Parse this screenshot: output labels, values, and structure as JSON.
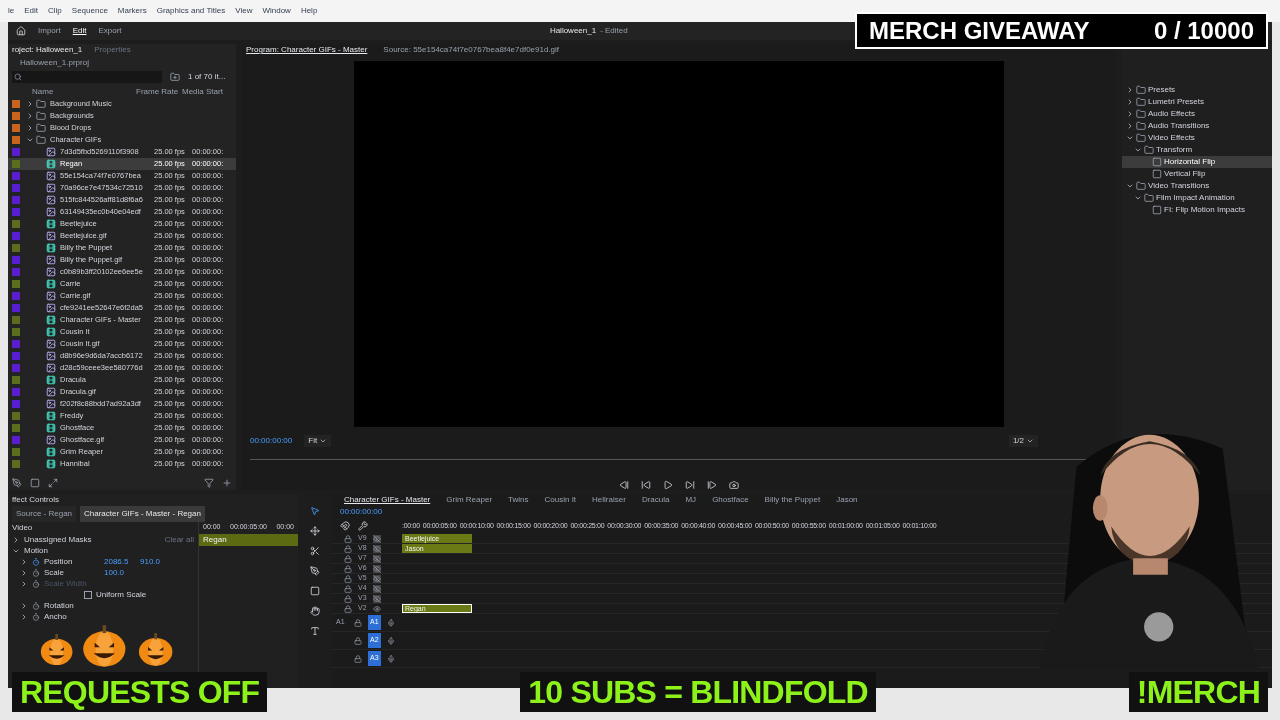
{
  "menu_bar": [
    "le",
    "Edit",
    "Clip",
    "Sequence",
    "Markers",
    "Graphics and Titles",
    "View",
    "Window",
    "Help"
  ],
  "header": {
    "workspaces": [
      {
        "label": "Import",
        "selected": false
      },
      {
        "label": "Edit",
        "selected": true
      },
      {
        "label": "Export",
        "selected": false
      }
    ],
    "title": "Halloween_1",
    "status": "- Edited"
  },
  "project": {
    "tabs": [
      {
        "label": "roject: Halloween_1",
        "selected": true
      },
      {
        "label": "Properties",
        "selected": false
      }
    ],
    "bin": "Halloween_1.prproj",
    "count": "1 of 70 it...",
    "columns": [
      "Name",
      "Frame Rate",
      "Media Start"
    ],
    "items": [
      {
        "kind": "folder",
        "name": "Background Music",
        "color": "#c8641e",
        "expanded": false,
        "selected": false
      },
      {
        "kind": "folder",
        "name": "Backgrounds",
        "color": "#c8641e",
        "expanded": false,
        "selected": false
      },
      {
        "kind": "folder",
        "name": "Blood Drops",
        "color": "#c8641e",
        "expanded": false,
        "selected": false
      },
      {
        "kind": "folder",
        "name": "Character GIFs",
        "color": "#c8641e",
        "expanded": true,
        "selected": false,
        "children": [
          {
            "kind": "gif",
            "name": "7d3d5fbd5269110f3908",
            "fps": "25.00 fps",
            "start": "00:00:00:",
            "color": "#5a1ed2",
            "selected": false
          },
          {
            "kind": "sequence",
            "name": "Regan",
            "fps": "25.00 fps",
            "start": "00:00:00:",
            "color": "#5a6e1e",
            "selected": true
          },
          {
            "kind": "gif",
            "name": "55e154ca74f7e0767bea",
            "fps": "25.00 fps",
            "start": "00:00:00:",
            "color": "#5a1ed2",
            "selected": false
          },
          {
            "kind": "gif",
            "name": "70a96ce7e47534c72510",
            "fps": "25.00 fps",
            "start": "00:00:00:",
            "color": "#5a1ed2",
            "selected": false
          },
          {
            "kind": "gif",
            "name": "515fc844526aff81d8f6a6",
            "fps": "25.00 fps",
            "start": "00:00:00:",
            "color": "#5a1ed2",
            "selected": false
          },
          {
            "kind": "gif",
            "name": "63149435ec0b40e04edf",
            "fps": "25.00 fps",
            "start": "00:00:00:",
            "color": "#5a1ed2",
            "selected": false
          },
          {
            "kind": "sequence",
            "name": "Beetlejuice",
            "fps": "25.00 fps",
            "start": "00:00:00:",
            "color": "#5a6e1e",
            "selected": false
          },
          {
            "kind": "gif",
            "name": "Beetlejuice.gif",
            "fps": "25.00 fps",
            "start": "00:00:00:",
            "color": "#5a1ed2",
            "selected": false
          },
          {
            "kind": "sequence",
            "name": "Billy the Puppet",
            "fps": "25.00 fps",
            "start": "00:00:00:",
            "color": "#5a6e1e",
            "selected": false
          },
          {
            "kind": "gif",
            "name": "Billy the Puppet.gif",
            "fps": "25.00 fps",
            "start": "00:00:00:",
            "color": "#5a1ed2",
            "selected": false
          },
          {
            "kind": "gif",
            "name": "c0b89b3ff20102ee6ee5e",
            "fps": "25.00 fps",
            "start": "00:00:00:",
            "color": "#5a1ed2",
            "selected": false
          },
          {
            "kind": "sequence",
            "name": "Carrie",
            "fps": "25.00 fps",
            "start": "00:00:00:",
            "color": "#5a6e1e",
            "selected": false
          },
          {
            "kind": "gif",
            "name": "Carrie.gif",
            "fps": "25.00 fps",
            "start": "00:00:00:",
            "color": "#5a1ed2",
            "selected": false
          },
          {
            "kind": "gif",
            "name": "cfe9241ee52647e6f2da5",
            "fps": "25.00 fps",
            "start": "00:00:00:",
            "color": "#5a1ed2",
            "selected": false
          },
          {
            "kind": "sequence",
            "name": "Character GIFs - Master",
            "fps": "25.00 fps",
            "start": "00:00:00:",
            "color": "#5a6e1e",
            "selected": false
          },
          {
            "kind": "sequence",
            "name": "Cousin It",
            "fps": "25.00 fps",
            "start": "00:00:00:",
            "color": "#5a6e1e",
            "selected": false
          },
          {
            "kind": "gif",
            "name": "Cousin It.gif",
            "fps": "25.00 fps",
            "start": "00:00:00:",
            "color": "#5a1ed2",
            "selected": false
          },
          {
            "kind": "gif",
            "name": "d8b96e9d6da7accb6172",
            "fps": "25.00 fps",
            "start": "00:00:00:",
            "color": "#5a1ed2",
            "selected": false
          },
          {
            "kind": "gif",
            "name": "d28c59ceee3ee580776d",
            "fps": "25.00 fps",
            "start": "00:00:00:",
            "color": "#5a1ed2",
            "selected": false
          },
          {
            "kind": "sequence",
            "name": "Dracula",
            "fps": "25.00 fps",
            "start": "00:00:00:",
            "color": "#5a6e1e",
            "selected": false
          },
          {
            "kind": "gif",
            "name": "Dracula.gif",
            "fps": "25.00 fps",
            "start": "00:00:00:",
            "color": "#5a1ed2",
            "selected": false
          },
          {
            "kind": "gif",
            "name": "f202f8c88bdd7ad92a3df",
            "fps": "25.00 fps",
            "start": "00:00:00:",
            "color": "#5a1ed2",
            "selected": false
          },
          {
            "kind": "sequence",
            "name": "Freddy",
            "fps": "25.00 fps",
            "start": "00:00:00:",
            "color": "#5a6e1e",
            "selected": false
          },
          {
            "kind": "sequence",
            "name": "Ghostface",
            "fps": "25.00 fps",
            "start": "00:00:00:",
            "color": "#5a6e1e",
            "selected": false
          },
          {
            "kind": "gif",
            "name": "Ghostface.gif",
            "fps": "25.00 fps",
            "start": "00:00:00:",
            "color": "#5a1ed2",
            "selected": false
          },
          {
            "kind": "sequence",
            "name": "Grim Reaper",
            "fps": "25.00 fps",
            "start": "00:00:00:",
            "color": "#5a6e1e",
            "selected": false
          },
          {
            "kind": "sequence",
            "name": "Hannibal",
            "fps": "25.00 fps",
            "start": "00:00:00:",
            "color": "#5a6e1e",
            "selected": false
          }
        ]
      }
    ]
  },
  "monitor": {
    "tabs": [
      {
        "label": "Program: Character GIFs - Master",
        "selected": true
      },
      {
        "label": "Source: 55e154ca74f7e0767bea8f4e7df0e91d.gif",
        "selected": false
      }
    ],
    "timecode": "00:00:00:00",
    "zoom": "Fit",
    "resolution": "1/2"
  },
  "effects": {
    "tree": [
      {
        "name": "Presets",
        "expanded": false,
        "selected": false
      },
      {
        "name": "Lumetri Presets",
        "expanded": false,
        "selected": false
      },
      {
        "name": "Audio Effects",
        "expanded": false,
        "selected": false
      },
      {
        "name": "Audio Transitions",
        "expanded": false,
        "selected": false
      },
      {
        "name": "Video Effects",
        "expanded": true,
        "selected": false,
        "children": [
          {
            "name": "Transform",
            "expanded": true,
            "selected": false,
            "children": [
              {
                "name": "Horizontal Flip",
                "selected": true
              },
              {
                "name": "Vertical Flip",
                "selected": false
              }
            ]
          }
        ]
      },
      {
        "name": "Video Transitions",
        "expanded": true,
        "selected": false,
        "children": [
          {
            "name": "Film Impact Animation",
            "expanded": true,
            "selected": false,
            "children": [
              {
                "name": "FI: Flip Motion Impacts",
                "selected": false
              }
            ]
          }
        ]
      }
    ]
  },
  "effect_controls": {
    "title": "ffect Controls",
    "tabs": [
      {
        "label": "Source - Regan",
        "selected": false
      },
      {
        "label": "Character GIFs - Master - Regan",
        "selected": true
      }
    ],
    "section": "Video",
    "rows": [
      {
        "kind": "group",
        "label": "Unassigned Masks",
        "action": "Clear all"
      },
      {
        "kind": "fx",
        "label": "Motion"
      },
      {
        "kind": "param",
        "label": "Position",
        "values": [
          "2086.5",
          "910.0"
        ],
        "animated": true,
        "disabled": false
      },
      {
        "kind": "param",
        "label": "Scale",
        "values": [
          "100.0"
        ],
        "animated": false,
        "disabled": false
      },
      {
        "kind": "param",
        "label": "Scale Width",
        "values": [],
        "animated": false,
        "disabled": true
      },
      {
        "kind": "checkbox",
        "label": "Uniform Scale",
        "checked": false
      },
      {
        "kind": "param",
        "label": "Rotation",
        "values": [],
        "animated": false,
        "disabled": false
      },
      {
        "kind": "param",
        "label": "Ancho",
        "values": [],
        "animated": false,
        "disabled": false
      }
    ],
    "ruler": [
      "00:00",
      "00:00:05:00",
      "00:00"
    ],
    "clip": "Regan"
  },
  "timeline": {
    "tabs": [
      {
        "label": "Character GIFs - Master",
        "selected": true
      },
      {
        "label": "Grim Reaper",
        "selected": false
      },
      {
        "label": "Twins",
        "selected": false
      },
      {
        "label": "Cousin It",
        "selected": false
      },
      {
        "label": "Hellraiser",
        "selected": false
      },
      {
        "label": "Dracula",
        "selected": false
      },
      {
        "label": "MJ",
        "selected": false
      },
      {
        "label": "Ghostface",
        "selected": false
      },
      {
        "label": "Billy the Puppet",
        "selected": false
      },
      {
        "label": "Jason",
        "selected": false
      }
    ],
    "timecode": "00:00:00:00",
    "ruler": [
      ":00:00",
      "00:00:05:00",
      "00:00:10:00",
      "00:00:15:00",
      "00:00:20:00",
      "00:00:25:00",
      "00:00:30:00",
      "00:00:35:00",
      "00:00:40:00",
      "00:00:45:00",
      "00:00:50:00",
      "00:00:55:00",
      "00:01:00:00",
      "00:01:05:00",
      "00:01:10:00"
    ],
    "video_tracks": [
      {
        "name": "V9",
        "visible": false,
        "clip": {
          "label": "Beetlejuice",
          "selected": false
        }
      },
      {
        "name": "V8",
        "visible": false,
        "clip": {
          "label": "Jason",
          "selected": false
        }
      },
      {
        "name": "V7",
        "visible": false
      },
      {
        "name": "V6",
        "visible": false
      },
      {
        "name": "V5",
        "visible": false
      },
      {
        "name": "V4",
        "visible": false
      },
      {
        "name": "V3",
        "visible": false
      },
      {
        "name": "V2",
        "visible": true,
        "clip": {
          "label": "Regan",
          "selected": true
        }
      }
    ],
    "audio_tracks": [
      {
        "name": "A1",
        "source": "A1",
        "targeted": true
      },
      {
        "name": "A2",
        "targeted": true
      },
      {
        "name": "A3",
        "targeted": true
      }
    ]
  },
  "overlay": {
    "giveaway": {
      "label": "MERCH GIVEAWAY",
      "count": "0 / 10000"
    },
    "banner": [
      "REQUESTS OFF",
      "10 SUBS = BLINDFOLD",
      "!MERCH"
    ],
    "webcam": {
      "kind": "picture"
    }
  }
}
